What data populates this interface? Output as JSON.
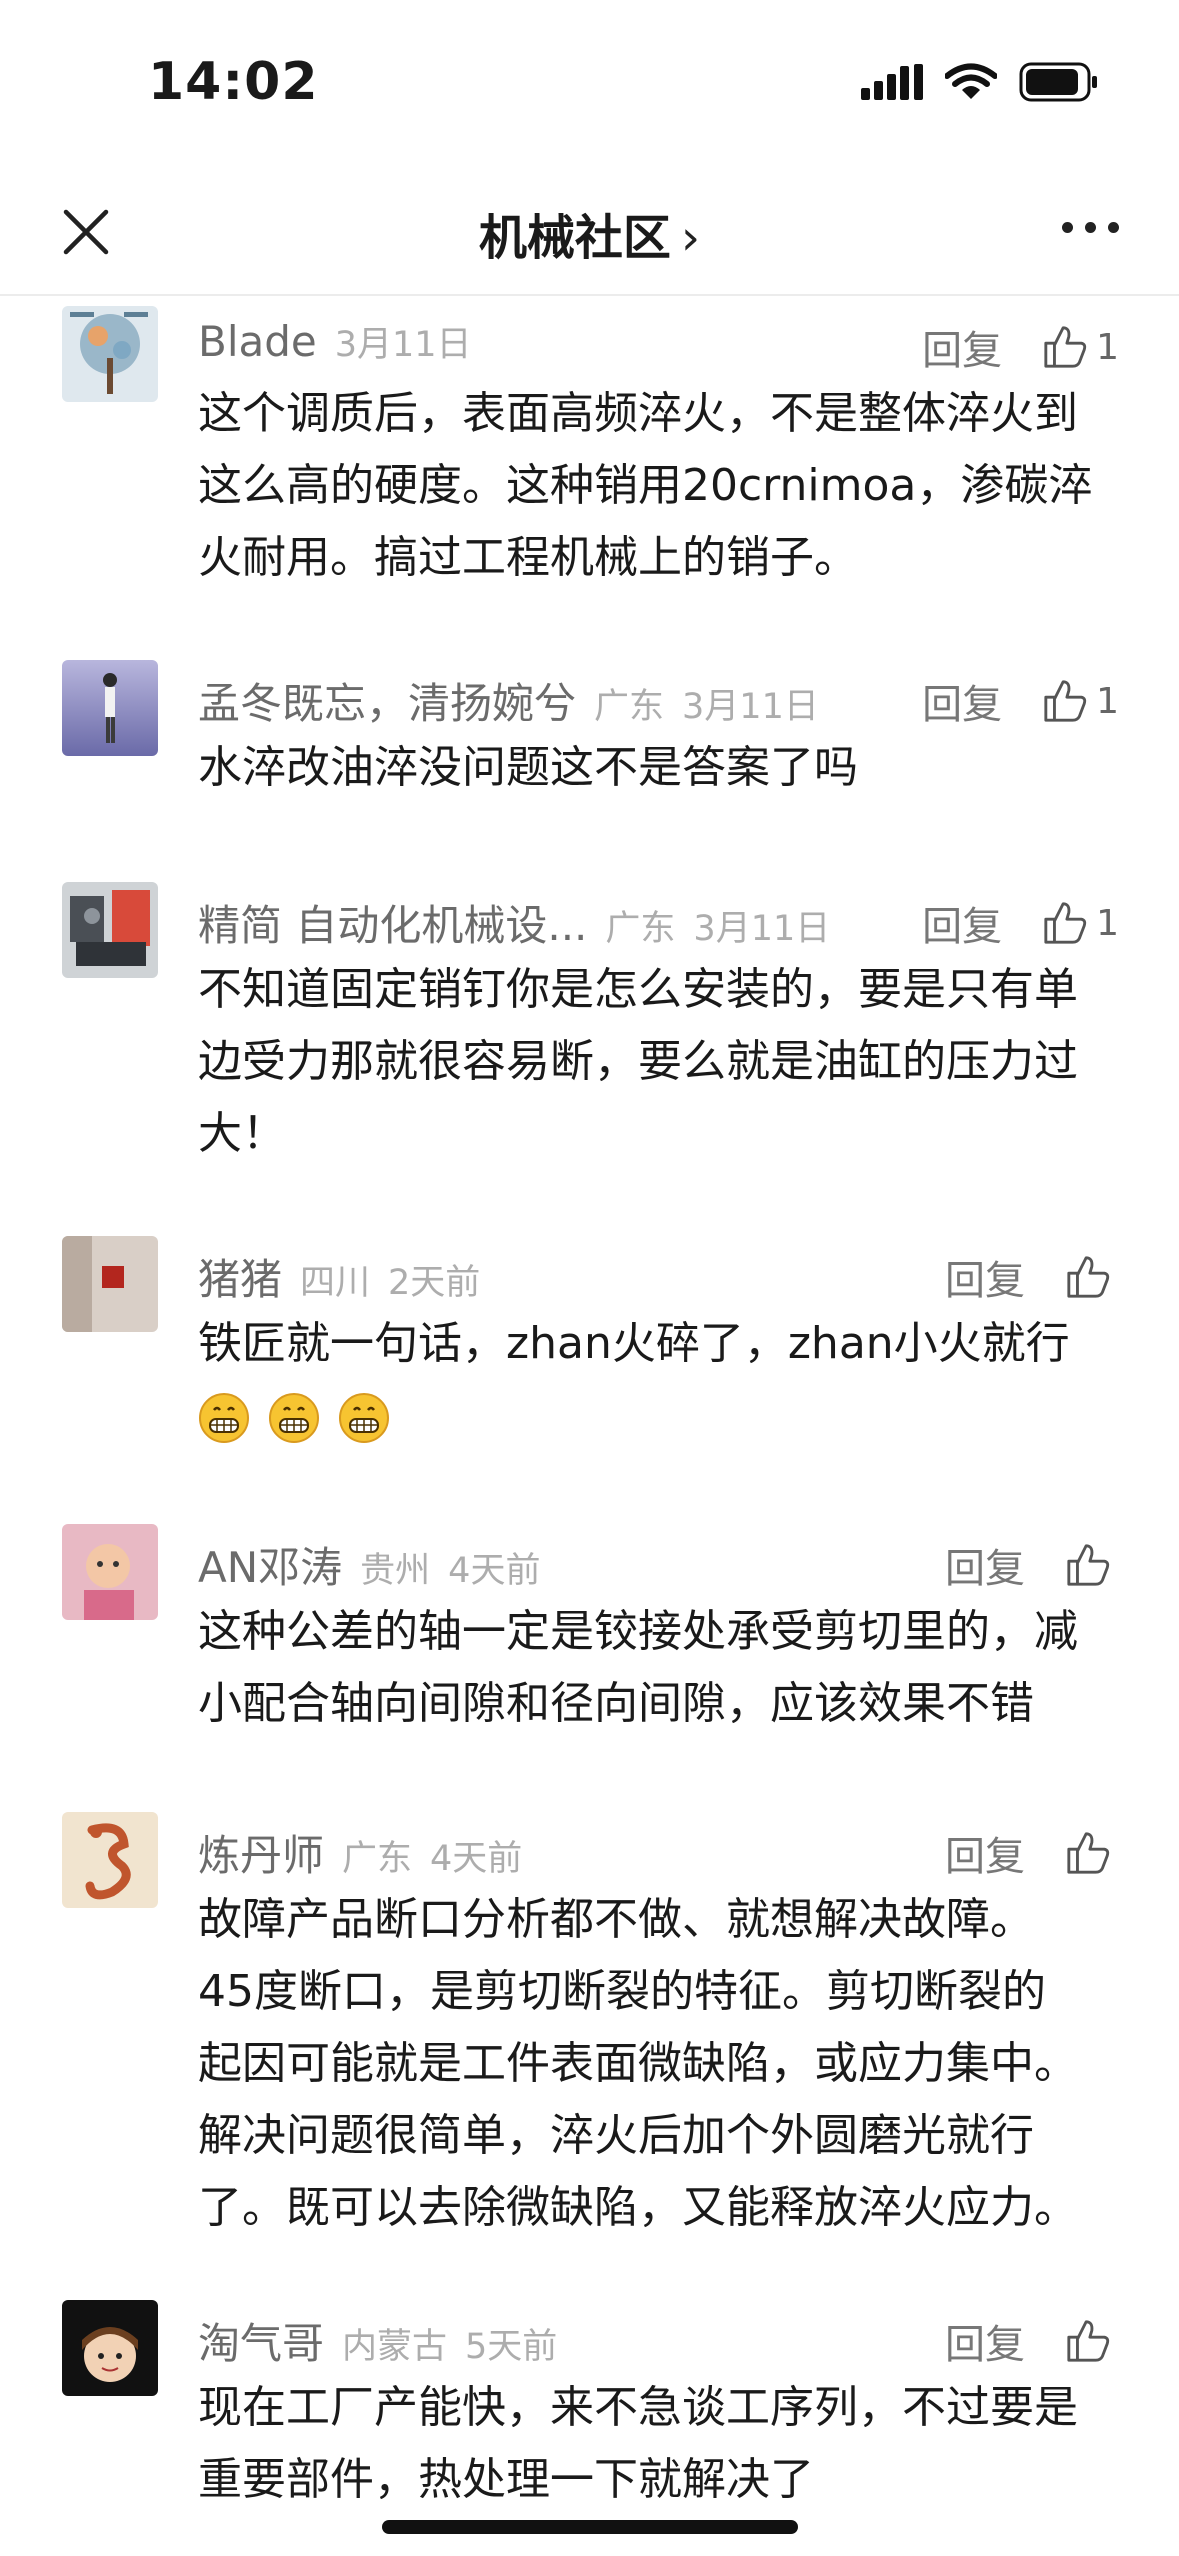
{
  "status": {
    "time": "14:02"
  },
  "nav": {
    "title": "机械社区",
    "chevron": "›"
  },
  "comments": [
    {
      "name": "Blade",
      "location": "",
      "date": "3月11日",
      "reply": "回复",
      "likes": "1",
      "lines": [
        "这个调质后，表面高频淬火，不是整体淬火到",
        "这么高的硬度。这种销用20crnimoa，渗碳淬",
        "火耐用。搞过工程机械上的销子。"
      ]
    },
    {
      "name": "孟冬既忘，清扬婉兮",
      "location": "广东",
      "date": "3月11日",
      "reply": "回复",
      "likes": "1",
      "lines": [
        "水淬改油淬没问题这不是答案了吗"
      ]
    },
    {
      "name": "精简 自动化机械设...",
      "location": "广东",
      "date": "3月11日",
      "reply": "回复",
      "likes": "1",
      "lines": [
        "不知道固定销钉你是怎么安装的，要是只有单",
        "边受力那就很容易断，要么就是油缸的压力过",
        "大！"
      ]
    },
    {
      "name": "猪猪",
      "location": "四川",
      "date": "2天前",
      "reply": "回复",
      "likes": "",
      "lines": [
        "铁匠就一句话，zhan火碎了，zhan小火就行"
      ]
    },
    {
      "name": "AN邓涛",
      "location": "贵州",
      "date": "4天前",
      "reply": "回复",
      "likes": "",
      "lines": [
        "这种公差的轴一定是铰接处承受剪切里的，减",
        "小配合轴向间隙和径向间隙，应该效果不错"
      ]
    },
    {
      "name": "炼丹师",
      "location": "广东",
      "date": "4天前",
      "reply": "回复",
      "likes": "",
      "lines": [
        "故障产品断口分析都不做、就想解决故障。",
        "45度断口，是剪切断裂的特征。剪切断裂的",
        "起因可能就是工件表面微缺陷，或应力集中。",
        "解决问题很简单，淬火后加个外圆磨光就行",
        "了。既可以去除微缺陷，又能释放淬火应力。"
      ]
    },
    {
      "name": "淘气哥",
      "location": "内蒙古",
      "date": "5天前",
      "reply": "回复",
      "likes": "",
      "lines": [
        "现在工厂产能快，来不急谈工序列，不过要是",
        "重要部件，热处理一下就解决了"
      ]
    }
  ]
}
